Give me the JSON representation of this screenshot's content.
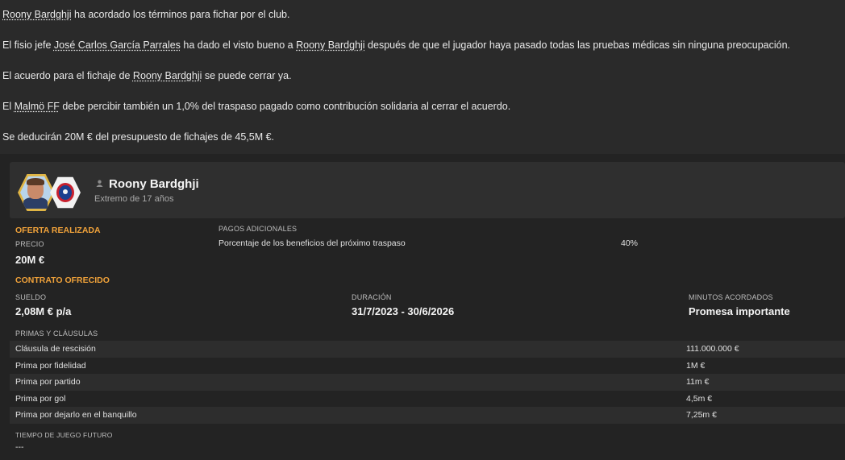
{
  "messages": {
    "line1": {
      "player": "Roony Bardghji",
      "rest": " ha acordado los términos para fichar por el club."
    },
    "line2": {
      "pre": "El fisio jefe ",
      "physio": "José Carlos García Parrales",
      "mid": " ha dado el visto bueno a ",
      "player": "Roony Bardghji",
      "rest": " después de que el jugador haya pasado todas las pruebas médicas sin ninguna preocupación."
    },
    "line3": {
      "pre": "El acuerdo para el fichaje de ",
      "player": "Roony Bardghji",
      "rest": " se puede cerrar ya."
    },
    "line4": {
      "pre": "El ",
      "club": "Malmö FF",
      "rest": " debe percibir también un 1,0% del traspaso pagado como contribución solidaria al cerrar el acuerdo."
    },
    "line5": "Se deducirán 20M € del presupuesto de fichajes de 45,5M €."
  },
  "player": {
    "name": "Roony Bardghji",
    "subtitle": "Extremo de 17 años",
    "icons": {
      "portrait": "player-portrait-icon",
      "club": "club-crest-icon",
      "person": "person-icon"
    }
  },
  "offer": {
    "title": "OFERTA REALIZADA",
    "price_label": "PRECIO",
    "price_value": "20M €",
    "extras_label": "PAGOS ADICIONALES",
    "extras_item": "Porcentaje de los beneficios del próximo traspaso",
    "extras_value": "40%"
  },
  "contract": {
    "title": "CONTRATO OFRECIDO",
    "wage_label": "SUELDO",
    "wage_value": "2,08M € p/a",
    "duration_label": "DURACIÓN",
    "duration_value": "31/7/2023 - 30/6/2026",
    "minutes_label": "MINUTOS ACORDADOS",
    "minutes_value": "Promesa importante",
    "bonuses_label": "PRIMAS Y CLÁUSULAS",
    "bonuses": [
      {
        "name": "Cláusula de rescisión",
        "value": "111.000.000 €"
      },
      {
        "name": "Prima por fidelidad",
        "value": "1M €"
      },
      {
        "name": "Prima por partido",
        "value": "11m €"
      },
      {
        "name": "Prima por gol",
        "value": "4,5m €"
      },
      {
        "name": "Prima por dejarlo en el banquillo",
        "value": "7,25m €"
      }
    ],
    "future_label": "TIEMPO DE JUEGO FUTURO",
    "future_value": "---"
  },
  "colors": {
    "accent": "#f0a23a",
    "background": "#2a2a2a",
    "panel": "#232323"
  }
}
